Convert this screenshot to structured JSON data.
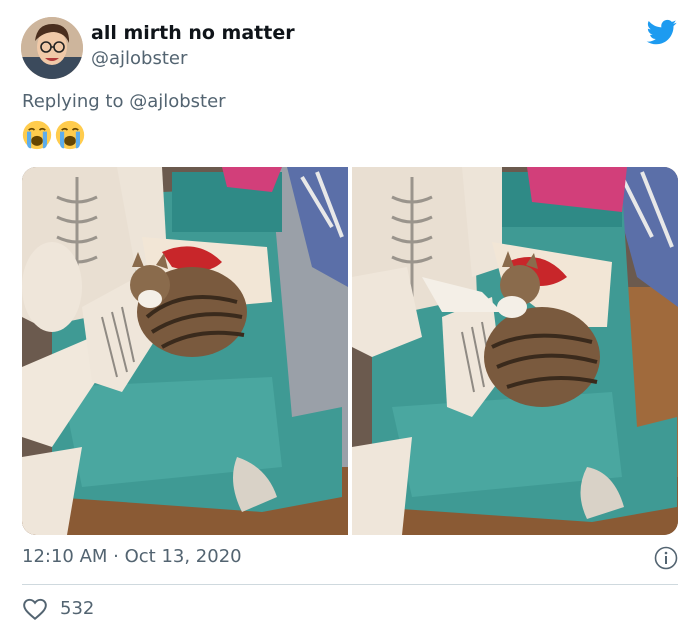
{
  "author": {
    "display_name": "all mirth no matter",
    "handle": "@ajlobster",
    "avatar_icon": "person-avatar"
  },
  "brand_icon": "twitter-bird-icon",
  "reply": {
    "prefix": "Replying to ",
    "handle": "@ajlobster"
  },
  "body": {
    "emojis": [
      "loudly-crying-face",
      "loudly-crying-face"
    ]
  },
  "media": {
    "count": 2,
    "photos": [
      "cat curled on teal armchair",
      "cat stretching on teal armchair"
    ]
  },
  "meta": {
    "timestamp": "12:10 AM · Oct 13, 2020"
  },
  "engagement": {
    "likes": "532"
  },
  "colors": {
    "brand": "#1d9bf0",
    "text_primary": "#0f1419",
    "text_secondary": "#536471",
    "divider": "#cfd9de"
  }
}
